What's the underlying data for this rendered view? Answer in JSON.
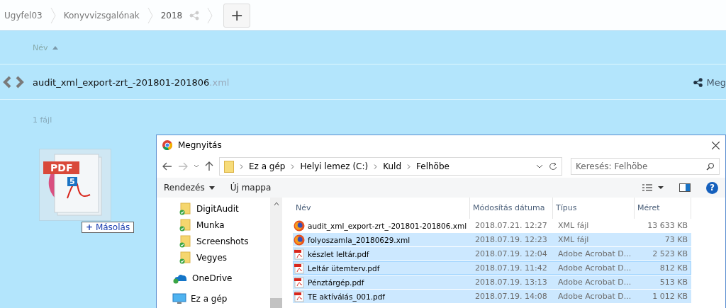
{
  "breadcrumb": [
    "Ugyfel03",
    "Konyvvizsgalónak",
    "2018"
  ],
  "add_button": "+",
  "list_header": {
    "label": "Név",
    "sort_ascending": true
  },
  "file_row": {
    "name": "audit_xml_export-zrt_-201801-201806",
    "ext": ".xml",
    "action": "Meg"
  },
  "file_count": "1 fájl",
  "drag": {
    "badge": "PDF",
    "number": "5",
    "label": "Másolás",
    "plus": "+"
  },
  "dialog": {
    "title": "Megnyitás",
    "path": [
      "Ez a gép",
      "Helyi lemez (C:)",
      "Kuld",
      "Felhöbe"
    ],
    "search": {
      "placeholder": "Keresés: Felhöbe"
    },
    "toolbar": [
      "Rendezés",
      "Új mappa"
    ],
    "help": "?",
    "nav": [
      {
        "label": "DigitAudit",
        "kind": "folder"
      },
      {
        "label": "Munka",
        "kind": "folder"
      },
      {
        "label": "Screenshots",
        "kind": "folder"
      },
      {
        "label": "Vegyes",
        "kind": "folder"
      },
      {
        "label": "OneDrive",
        "kind": "cloud"
      },
      {
        "label": "Ez a gép",
        "kind": "computer"
      }
    ],
    "columns": [
      "Név",
      "Módosítás dátuma",
      "Típus",
      "Méret"
    ],
    "rows": [
      {
        "name": "audit_xml_export-zrt_-201801-201806.xml",
        "date": "2018.07.21. 12:27",
        "type": "XML fájl",
        "size": "13 633 KB",
        "kind": "firefox",
        "selected": false,
        "focused": false
      },
      {
        "name": "folyoszamla_20180629.xml",
        "date": "2018.07.19. 12:23",
        "type": "XML fájl",
        "size": "73 KB",
        "kind": "firefox",
        "selected": true,
        "focused": false
      },
      {
        "name": "készlet leltár.pdf",
        "date": "2018.07.19. 12:04",
        "type": "Adobe Acrobat D...",
        "size": "2 523 KB",
        "kind": "pdf",
        "selected": true,
        "focused": false
      },
      {
        "name": "Leltár ütemterv.pdf",
        "date": "2018.07.19. 11:42",
        "type": "Adobe Acrobat D...",
        "size": "812 KB",
        "kind": "pdf",
        "selected": true,
        "focused": true
      },
      {
        "name": "Pénztárgép.pdf",
        "date": "2018.07.19. 13:13",
        "type": "Adobe Acrobat D...",
        "size": "513 KB",
        "kind": "pdf",
        "selected": true,
        "focused": false
      },
      {
        "name": "TE aktíválás_001.pdf",
        "date": "2018.07.19. 14:08",
        "type": "Adobe Acrobat D...",
        "size": "1 012 KB",
        "kind": "pdf",
        "selected": true,
        "focused": false
      }
    ]
  }
}
